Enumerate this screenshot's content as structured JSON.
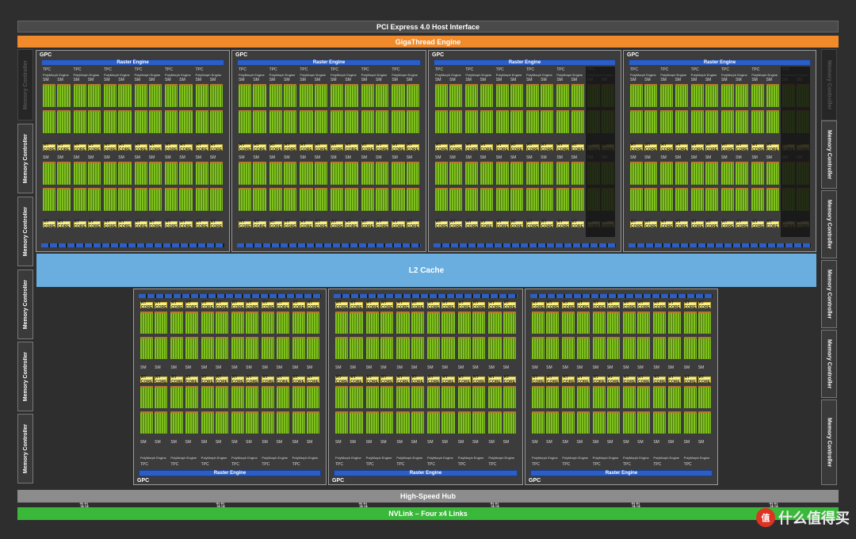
{
  "title_bar": {
    "pcie": "PCI Express 4.0 Host Interface",
    "gigathread": "GigaThread Engine"
  },
  "l2_cache": "L2 Cache",
  "high_speed_hub": "High-Speed Hub",
  "nvlink": "NVLink – Four x4 Links",
  "memory_controller_label": "Memory Controller",
  "gpc_label": "GPC",
  "raster_engine_label": "Raster Engine",
  "tpc_label": "TPC",
  "polymorph_label": "PolyMorph Engine",
  "sm_label": "SM",
  "rt_core_label": "RT CORE",
  "nvlink_arrows": "⇅⇅",
  "watermark": {
    "icon_text": "值",
    "text": "什么值得买"
  },
  "colors": {
    "giga": "#f08a2a",
    "l2": "#6aaee0",
    "nvlink": "#3ab83a",
    "core_green": "#7fc11d",
    "rt_core": "#f7f08a",
    "raster": "#2b5fc7"
  }
}
